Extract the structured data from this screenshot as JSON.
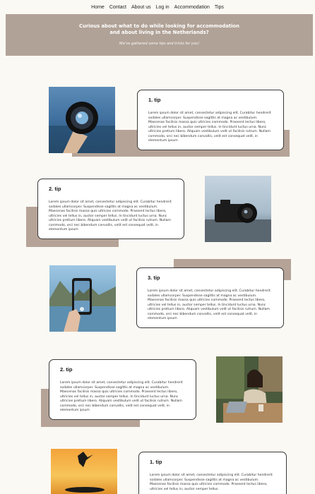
{
  "nav": {
    "home": "Home",
    "contact": "Contact",
    "about": "About us",
    "login": "Log in",
    "accommodation": "Accommodation",
    "tips": "Tips"
  },
  "hero": {
    "title_line1": "Curious about what to do while looking for accommodation",
    "title_line2": "and about living in the Netherlands?",
    "subtitle": "We've gathered some tips and tricks for you!"
  },
  "tips": [
    {
      "title": "1. tip",
      "text": "Lorem ipsum dolor sit amet, consectetur adipiscing elit. Curabitur hendrerit sodales ullamcorper. Suspendisse sagittis at magna ac vestibulum. Maecenas facilisis massa quis ultricies commodo. Praesent lectus libero, ultricies vel tellus in, auctor semper tellus. In tincidunt luctus urna. Nunc ultricies pretium libero. Aliquam vestibulum velit ut facilisis rutrum. Nullam commodo, orci nec bibendum convallis, velit est consequat velit, in elementum ipsum"
    },
    {
      "title": "2. tip",
      "text": "Lorem ipsum dolor sit amet, consectetur adipiscing elit. Curabitur hendrerit sodales ullamcorper. Suspendisse sagittis at magna ac vestibulum. Maecenas facilisis massa quis ultricies commodo. Praesent lectus libero, ultricies vel tellus in, auctor semper tellus. In tincidunt luctus urna. Nunc ultricies pretium libero. Aliquam vestibulum velit ut facilisis rutrum. Nullam commodo, orci nec bibendum convallis, velit est consequat velit, in elementum ipsum"
    },
    {
      "title": "3. tip",
      "text": "Lorem ipsum dolor sit amet, consectetur adipiscing elit. Curabitur hendrerit sodales ullamcorper. Suspendisse sagittis at magna ac vestibulum. Maecenas facilisis massa quis ultricies commodo. Praesent lectus libero, ultricies vel tellus in, auctor semper tellus. In tincidunt luctus urna. Nunc ultricies pretium libero. Aliquam vestibulum velit ut facilisis rutrum. Nullam commodo, orci nec bibendum convallis, velit est consequat velit, in elementum ipsum"
    },
    {
      "title": "2. tip",
      "text": "Lorem ipsum dolor sit amet, consectetur adipiscing elit. Curabitur hendrerit sodales ullamcorper. Suspendisse sagittis at magna ac vestibulum. Maecenas facilisis massa quis ultricies commodo. Praesent lectus libero, ultricies vel tellus in, auctor semper tellus. In tincidunt luctus urna. Nunc ultricies pretium libero. Aliquam vestibulum velit ut facilisis rutrum. Nullam commodo, orci nec bibendum convallis, velit est consequat velit, in elementum ipsum"
    },
    {
      "title": "1. tip",
      "text": "Lorem ipsum dolor sit amet, consectetur adipiscing elit. Curabitur hendrerit sodales ullamcorper. Suspendisse sagittis at magna ac vestibulum. Maecenas facilisis massa quis ultricies commodo. Praesent lectus libero, ultricies vel tellus in, auctor semper tellus."
    }
  ],
  "colors": {
    "background": "#fbf9f4",
    "hero": "#b1a297",
    "accent_block": "#b6a397"
  }
}
